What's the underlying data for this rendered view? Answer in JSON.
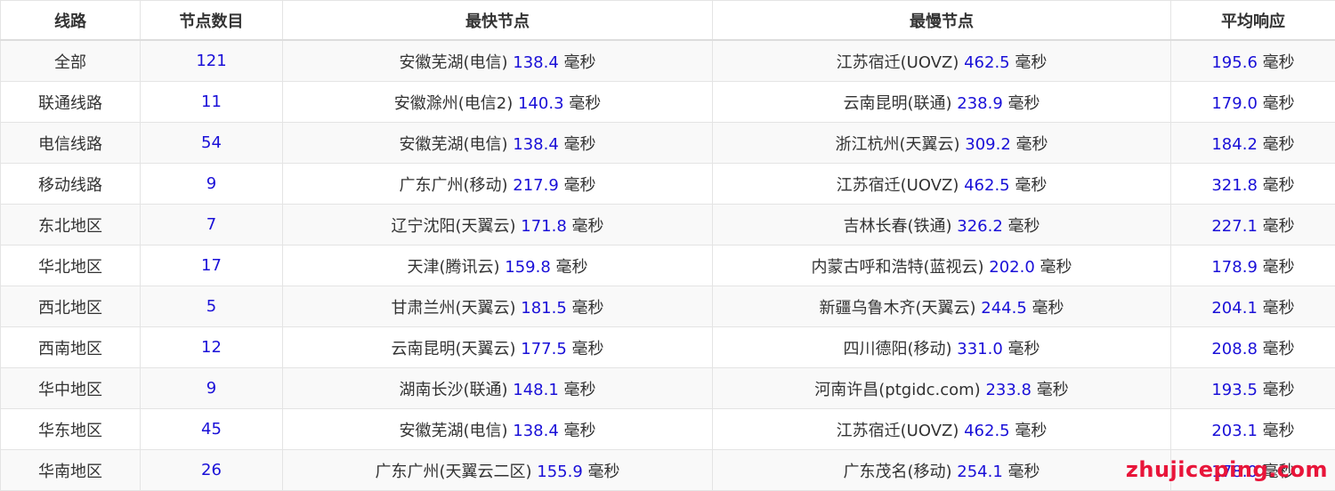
{
  "table": {
    "headers": [
      "线路",
      "节点数目",
      "最快节点",
      "最慢节点",
      "平均响应"
    ],
    "unit": "毫秒",
    "rows": [
      {
        "route": "全部",
        "count": "121",
        "fast_loc": "安徽芜湖(电信)",
        "fast_ms": "138.4",
        "slow_loc": "江苏宿迁(UOVZ)",
        "slow_ms": "462.5",
        "avg_ms": "195.6"
      },
      {
        "route": "联通线路",
        "count": "11",
        "fast_loc": "安徽滁州(电信2)",
        "fast_ms": "140.3",
        "slow_loc": "云南昆明(联通)",
        "slow_ms": "238.9",
        "avg_ms": "179.0"
      },
      {
        "route": "电信线路",
        "count": "54",
        "fast_loc": "安徽芜湖(电信)",
        "fast_ms": "138.4",
        "slow_loc": "浙江杭州(天翼云)",
        "slow_ms": "309.2",
        "avg_ms": "184.2"
      },
      {
        "route": "移动线路",
        "count": "9",
        "fast_loc": "广东广州(移动)",
        "fast_ms": "217.9",
        "slow_loc": "江苏宿迁(UOVZ)",
        "slow_ms": "462.5",
        "avg_ms": "321.8"
      },
      {
        "route": "东北地区",
        "count": "7",
        "fast_loc": "辽宁沈阳(天翼云)",
        "fast_ms": "171.8",
        "slow_loc": "吉林长春(铁通)",
        "slow_ms": "326.2",
        "avg_ms": "227.1"
      },
      {
        "route": "华北地区",
        "count": "17",
        "fast_loc": "天津(腾讯云)",
        "fast_ms": "159.8",
        "slow_loc": "内蒙古呼和浩特(蓝视云)",
        "slow_ms": "202.0",
        "avg_ms": "178.9"
      },
      {
        "route": "西北地区",
        "count": "5",
        "fast_loc": "甘肃兰州(天翼云)",
        "fast_ms": "181.5",
        "slow_loc": "新疆乌鲁木齐(天翼云)",
        "slow_ms": "244.5",
        "avg_ms": "204.1"
      },
      {
        "route": "西南地区",
        "count": "12",
        "fast_loc": "云南昆明(天翼云)",
        "fast_ms": "177.5",
        "slow_loc": "四川德阳(移动)",
        "slow_ms": "331.0",
        "avg_ms": "208.8"
      },
      {
        "route": "华中地区",
        "count": "9",
        "fast_loc": "湖南长沙(联通)",
        "fast_ms": "148.1",
        "slow_loc": "河南许昌(ptgidc.com)",
        "slow_ms": "233.8",
        "avg_ms": "193.5"
      },
      {
        "route": "华东地区",
        "count": "45",
        "fast_loc": "安徽芜湖(电信)",
        "fast_ms": "138.4",
        "slow_loc": "江苏宿迁(UOVZ)",
        "slow_ms": "462.5",
        "avg_ms": "203.1"
      },
      {
        "route": "华南地区",
        "count": "26",
        "fast_loc": "广东广州(天翼云二区)",
        "fast_ms": "155.9",
        "slow_loc": "广东茂名(移动)",
        "slow_ms": "254.1",
        "avg_ms": "178.0"
      }
    ]
  },
  "watermark": "zhujiceping.com",
  "colors": {
    "number": "#1a10d8",
    "watermark": "#e8153a"
  }
}
